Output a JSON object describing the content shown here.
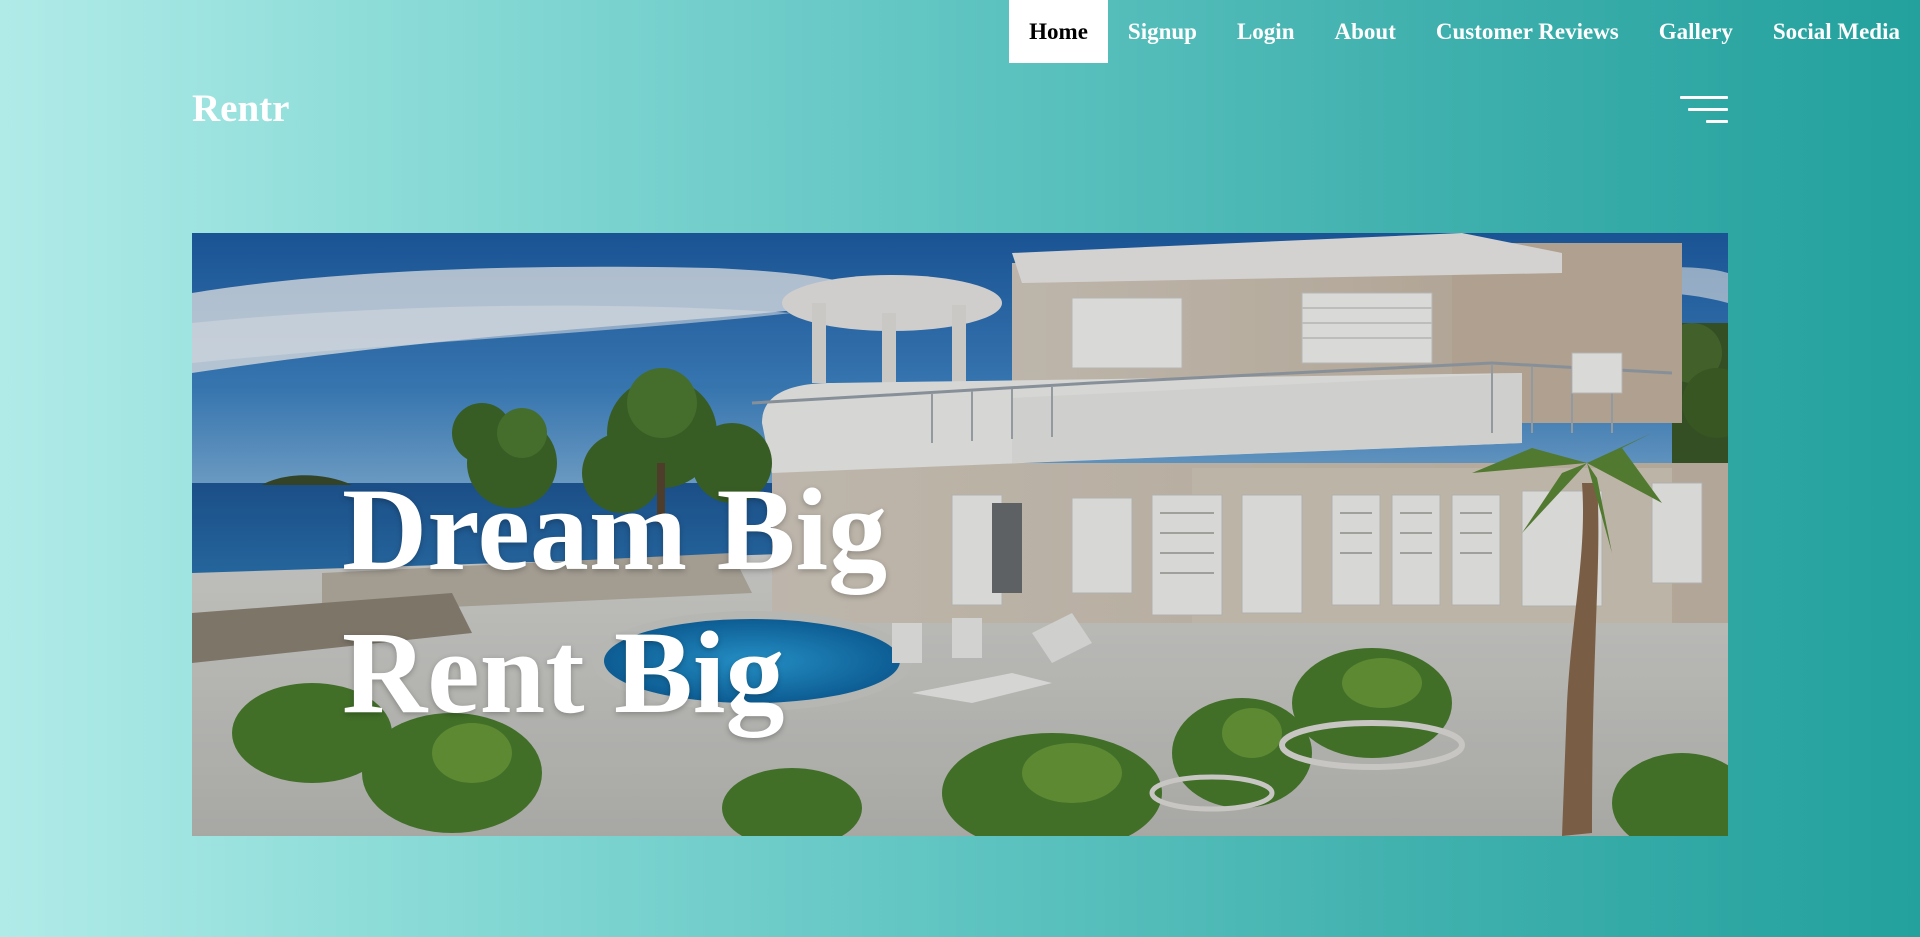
{
  "nav": {
    "items": [
      {
        "label": "Home",
        "active": true
      },
      {
        "label": "Signup"
      },
      {
        "label": "Login"
      },
      {
        "label": "About"
      },
      {
        "label": "Customer Reviews"
      },
      {
        "label": "Gallery"
      },
      {
        "label": "Social Media"
      }
    ]
  },
  "brand": {
    "name": "Rentr"
  },
  "hero": {
    "line1": "Dream Big",
    "line2": "Rent Big"
  },
  "icons": {
    "menu": "hamburger-menu-icon"
  },
  "colors": {
    "accent": "#23a19d",
    "gradient_start": "#b1ebe8",
    "gradient_end": "#23a19d",
    "active_tab_bg": "#ffffff"
  }
}
